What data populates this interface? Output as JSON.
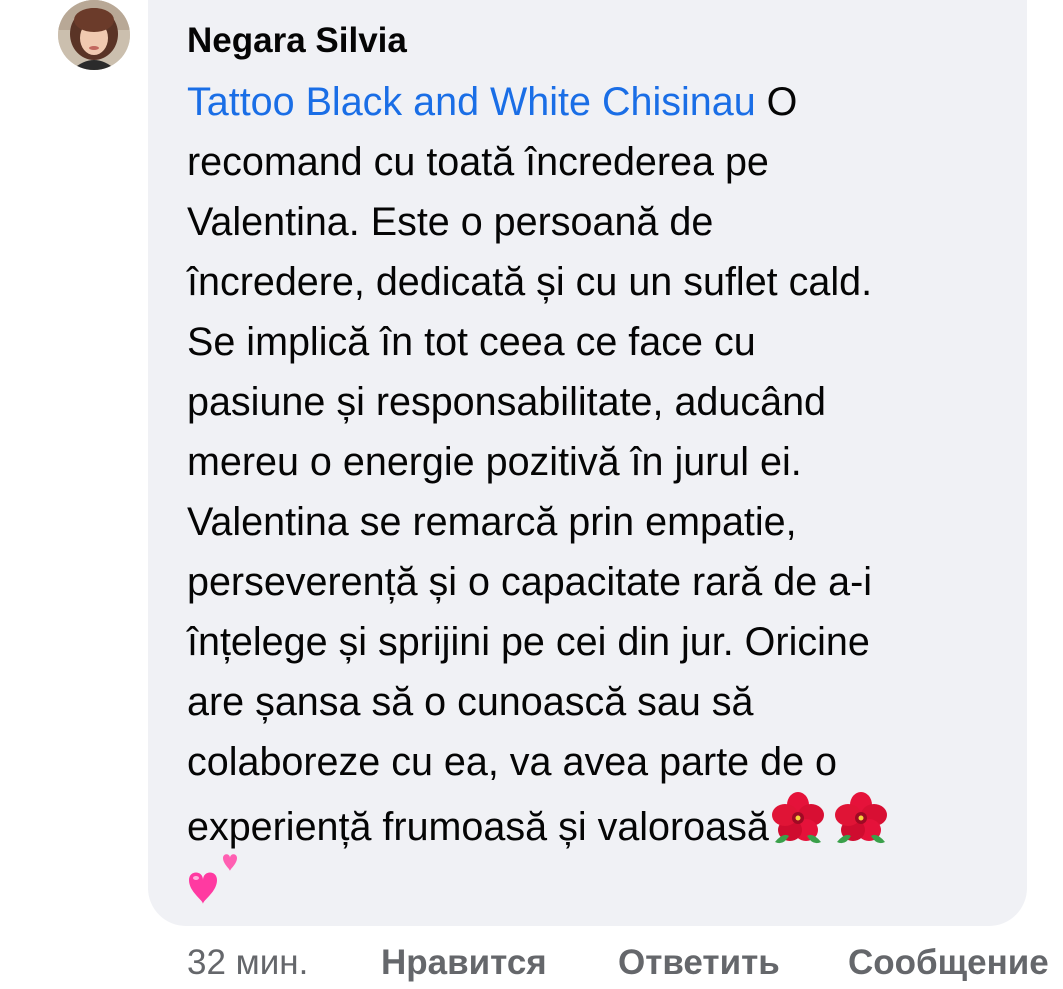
{
  "comment": {
    "author": "Negara Silvia",
    "mention": "Tattoo Black and White Chisinau",
    "lines": [
      " O",
      "recomand cu toată încrederea pe",
      "Valentina. Este o persoană de",
      "încredere, dedicată și cu un suflet cald.",
      "Se implică în tot ceea ce face cu",
      "pasiune și responsabilitate, aducând",
      "mereu o energie pozitivă în jurul ei.",
      "Valentina se remarcă prin empatie,",
      "perseverență și o capacitate rară de a-i",
      "înțelege și sprijini pe cei din jur. Oricine",
      "are șansa să o cunoască sau să",
      "colaboreze cu ea, va avea parte de o",
      "experiență frumoasă și valoroasă"
    ],
    "emojis": [
      "hibiscus-emoji",
      "hibiscus-emoji",
      "two-hearts-emoji"
    ]
  },
  "actions": {
    "timestamp": "32 мин.",
    "like": "Нравится",
    "reply": "Ответить",
    "message": "Сообщение"
  },
  "colors": {
    "bubble": "#f0f1f5",
    "text": "#050505",
    "mention": "#1a6ee6",
    "meta": "#65676b"
  }
}
